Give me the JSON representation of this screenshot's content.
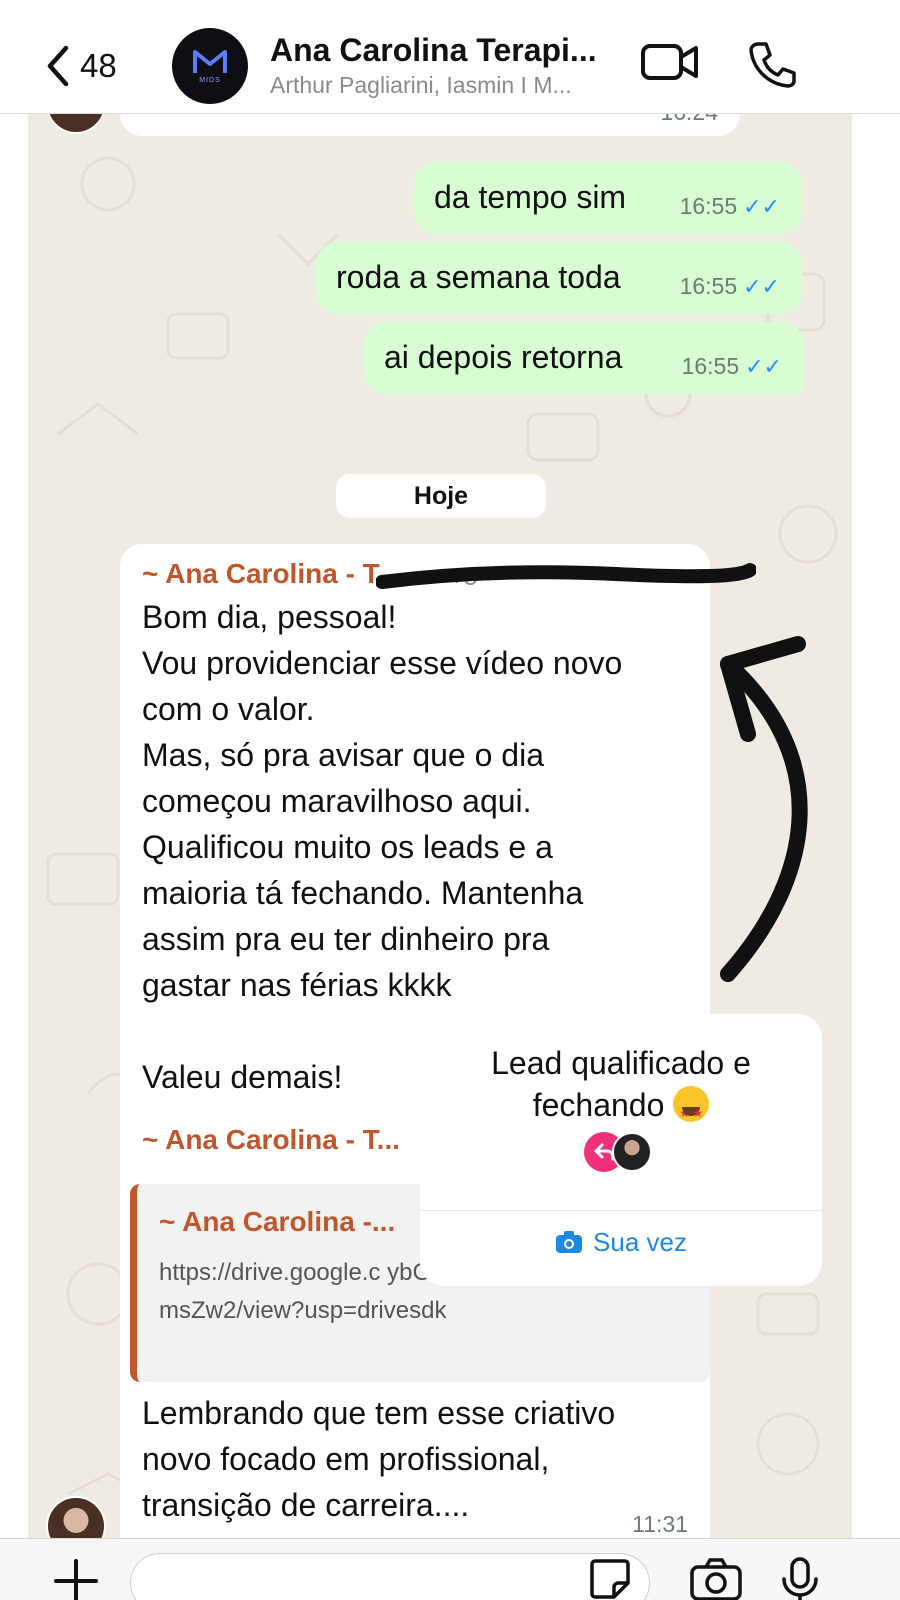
{
  "header": {
    "back_count": "48",
    "title": "Ana Carolina Terapi...",
    "subtitle": "Arthur Pagliarini, Iasmin I M...",
    "avatar_label": "MIDS",
    "icons": {
      "back": "chevron-left-icon",
      "video": "video-call-icon",
      "phone": "phone-icon"
    }
  },
  "chat": {
    "partial_top_time": "16:24",
    "outgoing": [
      {
        "text": "da tempo sim",
        "time": "16:55"
      },
      {
        "text": "roda a semana toda",
        "time": "16:55"
      },
      {
        "text": "ai depois retorna",
        "time": "16:55"
      }
    ],
    "date_divider": "Hoje",
    "message1": {
      "sender": "~ Ana Carolina - T...",
      "phone_partial": "+5",
      "lines": [
        "Bom dia, pessoal!",
        "Vou providenciar esse vídeo novo",
        "com o valor.",
        "Mas, só pra avisar que o dia",
        "começou maravilhoso aqui.",
        "Qualificou muito os leads e a",
        "maioria tá fechando.  Mantenha",
        "assim pra eu ter dinheiro pra",
        "gastar nas férias kkkk",
        "",
        "Valeu demais!"
      ]
    },
    "message2": {
      "sender": "~ Ana Carolina - T...",
      "quote_sender": "~ Ana Carolina -...",
      "quote_link": "https://drive.google.c                           ybG2jOg39xk5UlhGiPp-UQtmsZw2/view?usp=drivesdk",
      "lines": [
        "Lembrando que tem esse criativo",
        "novo focado em profissional,",
        "transição de carreira...."
      ],
      "time": "11:31"
    }
  },
  "reaction_card": {
    "line1": "Lead qualificado e",
    "line2": "fechando",
    "emoji": "star-struck-emoji",
    "action": "Sua vez",
    "action_icon": "camera-icon"
  },
  "bottom": {
    "icons": [
      "plus-icon",
      "sticker-icon",
      "camera-icon",
      "microphone-icon"
    ]
  },
  "colors": {
    "outgoing_bubble": "#d9fdd3",
    "sender_name": "#c0562b",
    "read_ticks": "#2f8cf3",
    "chat_bg": "#efeae2",
    "reaction_action": "#1e88e5"
  }
}
